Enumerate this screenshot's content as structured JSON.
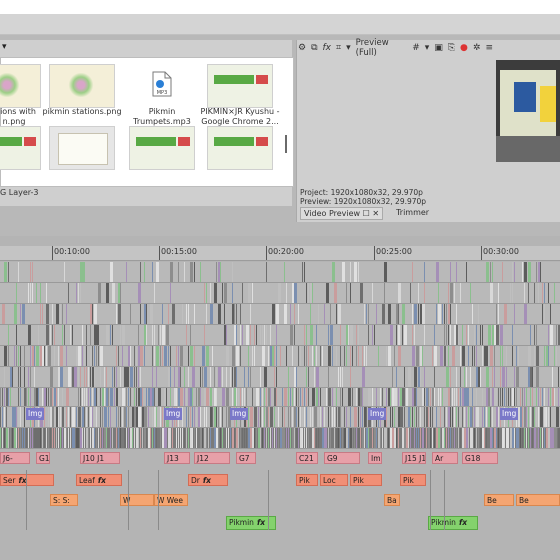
{
  "explorer": {
    "files": [
      {
        "label": "ations with\nn.png",
        "kind": "ask"
      },
      {
        "label": "pikmin stations.png",
        "kind": "ask"
      },
      {
        "label": "Pikmin\nTrumpets.mp3",
        "kind": "mp3"
      },
      {
        "label": "PIKMIN×JR Kyushu -\nGoogle Chrome 2...",
        "kind": "pik"
      }
    ],
    "row2_thumbs": [
      "pik",
      "paper",
      "pik",
      "pik"
    ],
    "mp3_badge": "MP3",
    "layer_label": "G Layer-3"
  },
  "preview": {
    "label": "Preview (Full)",
    "project": "Project:  1920x1080x32, 29.970p",
    "preview": "Preview:  1920x1080x32, 29.970p",
    "tabs": [
      {
        "label": "Video Preview",
        "active": true
      },
      {
        "label": "Trimmer",
        "active": false
      }
    ],
    "icons": [
      "gear-icon",
      "copy-icon",
      "fx-icon",
      "overlay-icon",
      "dropdown-icon",
      "grid-icon",
      "dropdown-icon",
      "save-frame-icon",
      "copy-frame-icon",
      "record-icon",
      "settings-icon",
      "more-icon"
    ]
  },
  "timeline": {
    "ruler": [
      "00:10:00",
      "00:15:00",
      "00:20:00",
      "00:25:00",
      "00:30:00"
    ],
    "clips": {
      "pink_labels": [
        "J6-",
        "G1",
        "J10 J1",
        "J13",
        "J12",
        "G7",
        "C21",
        "G9",
        "Im",
        "J15 J1",
        "Ar",
        "G18"
      ],
      "salmon_labels": [
        "Ser",
        "Leaf",
        "Dr",
        "Pik",
        "Loc",
        "Pik",
        "Pik"
      ],
      "orange_labels": [
        "S: S:",
        "W",
        "W Wee",
        "Ba",
        "Be",
        "Be"
      ],
      "green_labels": [
        "Pikmin",
        "Pikmin"
      ],
      "img_labels": [
        "Img",
        "Img",
        "Img",
        "Img",
        "Img"
      ],
      "fx": "fx"
    }
  }
}
